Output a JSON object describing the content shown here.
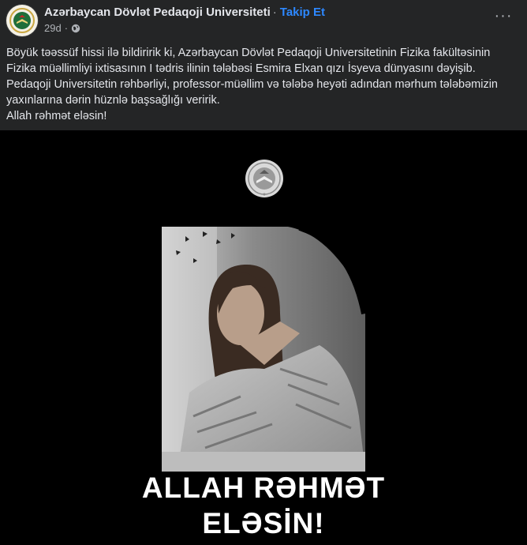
{
  "header": {
    "page_name": "Azərbaycan Dövlət Pedaqoji Universiteti",
    "separator": "·",
    "follow_label": "Takip Et",
    "timestamp": "29d",
    "meta_separator": "·",
    "more_label": "···"
  },
  "post": {
    "lines": [
      "Böyük təəssüf hissi ilə bildiririk ki, Azərbaycan Dövlət Pedaqoji Universitetinin Fizika fakültəsinin",
      "Fizika müəllimliyi ixtisasının I tədris ilinin tələbəsi Esmira Elxan qızı İsyeva  dünyasını dəyişib.",
      "Pedaqoji Universitetin rəhbərliyi, professor-müəllim və tələbə heyəti adından mərhum tələbəmizin",
      "yaxınlarına dərin hüznlə başsağlığı veririk.",
      "Allah rəhmət eləsin!"
    ]
  },
  "image": {
    "caption_line_1": "ALLAH RƏHMƏT",
    "caption_line_2": "ELƏSİN!"
  },
  "icons": {
    "avatar": "university-seal-icon",
    "globe": "globe-icon",
    "more": "more-options-icon"
  },
  "colors": {
    "background": "#242526",
    "text": "#e4e6eb",
    "secondary_text": "#b0b3b8",
    "link": "#2d88ff",
    "image_background": "#000000"
  }
}
